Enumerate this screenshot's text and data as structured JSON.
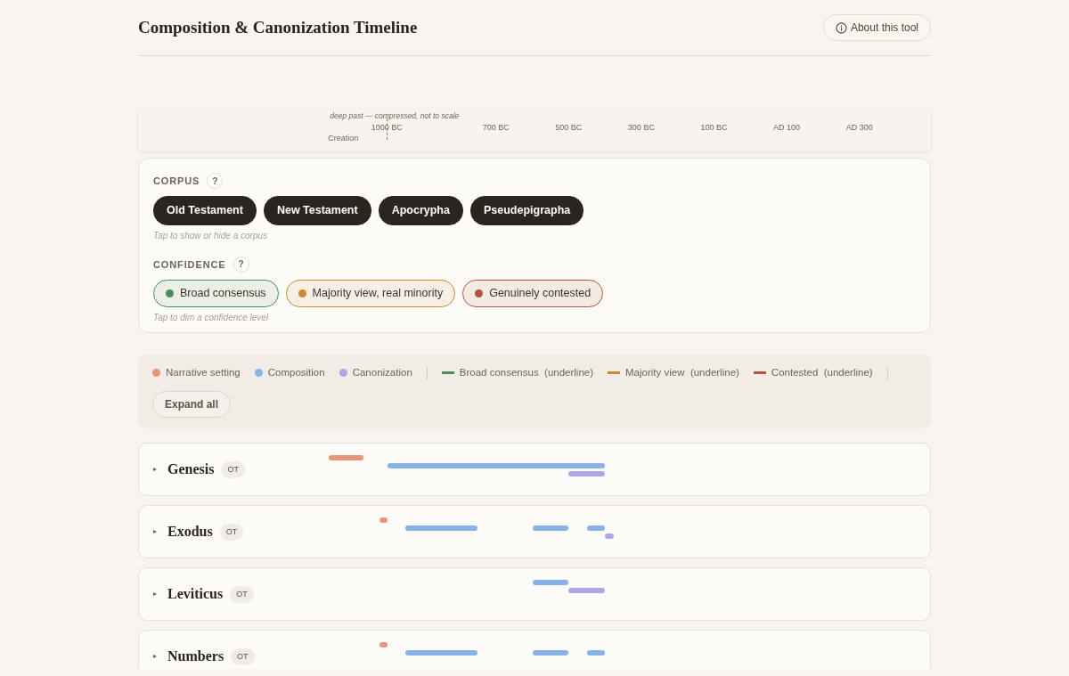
{
  "header": {
    "title": "Composition & Canonization Timeline",
    "about_button": "About this tool"
  },
  "axis": {
    "note": "deep past — compressed, not to scale",
    "start_label": "Creation",
    "ticks": [
      "1000 BC",
      "700 BC",
      "500 BC",
      "300 BC",
      "100 BC",
      "AD 100",
      "AD 300"
    ]
  },
  "corpus": {
    "label": "CORPUS",
    "help": "?",
    "hint": "Tap to show or hide a corpus",
    "chips": [
      {
        "label": "Old Testament",
        "selected": true
      },
      {
        "label": "New Testament",
        "selected": true
      },
      {
        "label": "Apocrypha",
        "selected": true
      },
      {
        "label": "Pseudepigrapha",
        "selected": true
      }
    ]
  },
  "confidence": {
    "label": "CONFIDENCE",
    "help": "?",
    "hint": "Tap to dim a confidence level",
    "chips": [
      {
        "label": "Broad consensus",
        "color": "#4a8c5c",
        "selected": true
      },
      {
        "label": "Majority view, real minority",
        "color": "#c98a35",
        "selected": true
      },
      {
        "label": "Genuinely contested",
        "color": "#b5533f",
        "selected": true
      }
    ]
  },
  "legend": {
    "items": [
      {
        "kind": "dot",
        "label": "Narrative setting",
        "color": "#e8967a"
      },
      {
        "kind": "dot",
        "label": "Composition",
        "color": "#86b2e6"
      },
      {
        "kind": "dot",
        "label": "Canonization",
        "color": "#b0a5e6"
      },
      {
        "kind": "divider"
      },
      {
        "kind": "line",
        "label": "Broad consensus  (underline)",
        "color": "#4a8c5c"
      },
      {
        "kind": "line",
        "label": "Majority view  (underline)",
        "color": "#c98a35"
      },
      {
        "kind": "line",
        "label": "Contested  (underline)",
        "color": "#b5533f"
      },
      {
        "kind": "divider"
      }
    ],
    "expand_button": "Expand all"
  },
  "books": [
    {
      "caret": "▸",
      "title": "Genesis",
      "tag": "OT",
      "expanded": false
    },
    {
      "caret": "▸",
      "title": "Exodus",
      "tag": "OT",
      "expanded": false
    },
    {
      "caret": "▸",
      "title": "Leviticus",
      "tag": "OT",
      "expanded": false
    },
    {
      "caret": "▸",
      "title": "Numbers",
      "tag": "OT",
      "expanded": false
    }
  ]
}
